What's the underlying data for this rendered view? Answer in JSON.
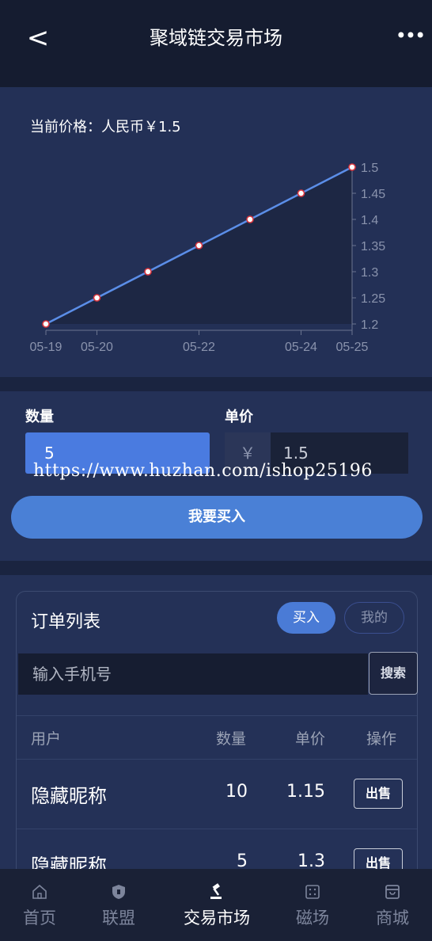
{
  "header": {
    "back_icon": "back-chevron-icon",
    "title": "聚域链交易市场",
    "more_icon": "more-dots-icon"
  },
  "price": {
    "label": "当前价格：人民币￥1.5"
  },
  "chart_data": {
    "type": "line",
    "x": [
      "05-19",
      "05-20",
      "05-21",
      "05-22",
      "05-23",
      "05-24",
      "05-25"
    ],
    "x_tick_labels": [
      "05-19",
      "05-20",
      "05-22",
      "05-24",
      "05-25"
    ],
    "values": [
      1.2,
      1.25,
      1.3,
      1.35,
      1.4,
      1.45,
      1.5
    ],
    "y_ticks": [
      "1.2",
      "1.25",
      "1.3",
      "1.35",
      "1.4",
      "1.45",
      "1.5"
    ],
    "ylim": [
      1.2,
      1.5
    ],
    "y_axis_side": "right",
    "grid": false,
    "line_color": "#5b8ee8",
    "marker_fill": "#ffffff",
    "marker_stroke": "#d9363e",
    "area_fill": "#1d2744"
  },
  "trade": {
    "qty_label": "数量",
    "qty_value": "5",
    "price_label": "单价",
    "currency_symbol": "￥",
    "price_value": "1.5",
    "watermark": "https://www.huzhan.com/ishop25196",
    "buy_button": "我要买入"
  },
  "orders": {
    "title": "订单列表",
    "tab_buy": "买入",
    "tab_mine": "我的",
    "search_placeholder": "输入手机号",
    "search_button": "搜索",
    "columns": {
      "user": "用户",
      "qty": "数量",
      "price": "单价",
      "action": "操作"
    },
    "rows": [
      {
        "user": "隐藏昵称",
        "qty": "10",
        "price": "1.15",
        "action": "出售"
      },
      {
        "user": "隐藏昵称",
        "qty": "5",
        "price": "1.3",
        "action": "出售"
      }
    ]
  },
  "tabbar": {
    "items": [
      {
        "label": "首页",
        "icon": "home-icon"
      },
      {
        "label": "联盟",
        "icon": "shield-icon"
      },
      {
        "label": "交易市场",
        "icon": "gavel-icon"
      },
      {
        "label": "磁场",
        "icon": "grid-icon"
      },
      {
        "label": "商城",
        "icon": "store-icon"
      }
    ],
    "active_index": 2
  },
  "colors": {
    "background": "#1a2440",
    "card": "#243157",
    "accent": "#4a80d6"
  }
}
